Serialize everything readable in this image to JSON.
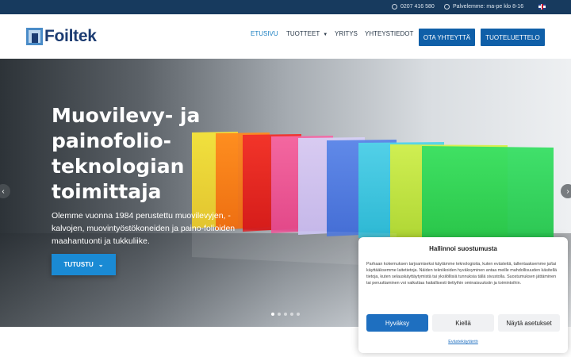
{
  "topbar": {
    "phone": "0207 416 580",
    "hours": "Palvelemme: ma-pe klo 8-16",
    "language_flag": "uk-flag-icon"
  },
  "header": {
    "logo_text": "Foiltek",
    "nav": {
      "home": "ETUSIVU",
      "products": "TUOTTEET",
      "company": "YRITYS",
      "contacts": "YHTEYSTIEDOT"
    },
    "contact_button": "OTA YHTEYTTÄ",
    "catalog_button": "TUOTELUETTELO",
    "brand_color": "#0f5fa8"
  },
  "hero": {
    "title": "Muovilevy- ja painofolio-teknologian toimittaja",
    "subtitle": "Olemme vuonna 1984 perustettu muovilevyjen, -kalvojen, muovintyöstökoneiden ja paino-folioiden maahantuonti ja tukkuliike.",
    "cta_label": "TUTUSTU",
    "slide_count": 5,
    "active_slide": 1
  },
  "cookie": {
    "title": "Hallinnoi suostumusta",
    "body": "Parhaan kokemuksen tarjoamiseksi käytämme teknologioita, kuten evästeitä, tallentaaksemme ja/tai käyttääksemme laitetietoja. Näiden tekniikoiden hyväksyminen antaa meille mahdollisuuden käsitellä tietoja, kuten selauskäyttäytymistä tai yksilöllisiä tunnuksia tällä sivustolla. Suostumuksen jättäminen tai peruuttaminen voi vaikuttaa haitallisesti tiettyihin ominaisuuksiin ja toimintoihin.",
    "accept": "Hyväksy",
    "deny": "Kiellä",
    "settings": "Näytä asetukset",
    "policy_link": "Evästekäytäntö"
  }
}
